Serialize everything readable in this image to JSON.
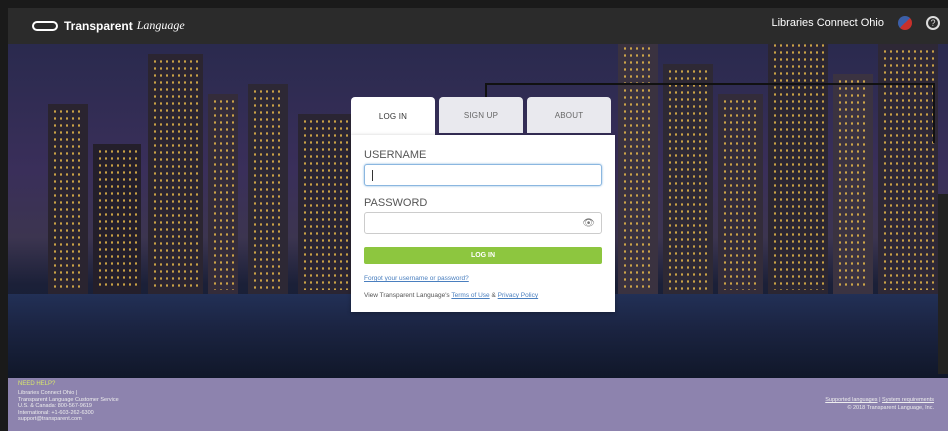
{
  "header": {
    "logo_name": "Transparent",
    "logo_word": "Language",
    "library": "Libraries Connect Ohio",
    "help_glyph": "?"
  },
  "login": {
    "tabs": [
      "LOG IN",
      "SIGN UP",
      "ABOUT"
    ],
    "username_label": "USERNAME",
    "password_label": "PASSWORD",
    "eye_glyph": "👁",
    "button_label": "LOG IN",
    "forgot_link": "Forgot your username or password?",
    "terms_prefix": "View Transparent Language's",
    "terms_link": "Terms of Use",
    "terms_amp": "&",
    "privacy_link": "Privacy Policy"
  },
  "footer": {
    "need_help": "NEED HELP?",
    "info_lines": [
      "Libraries Connect Ohio |",
      "Transparent Language Customer Service",
      "U.S. & Canada: 800-567-9619",
      "International: +1-603-262-6300",
      "support@transparent.com"
    ],
    "supported_languages": "Supported languages",
    "separator": "|",
    "system_requirements": "System requirements",
    "copyright": "© 2018 Transparent Language, Inc."
  },
  "colors": {
    "accent_green": "#8dc63f",
    "footer_bg": "#8d83ae",
    "topbar_bg": "#2b2b2b",
    "link": "#4a7fbf"
  }
}
